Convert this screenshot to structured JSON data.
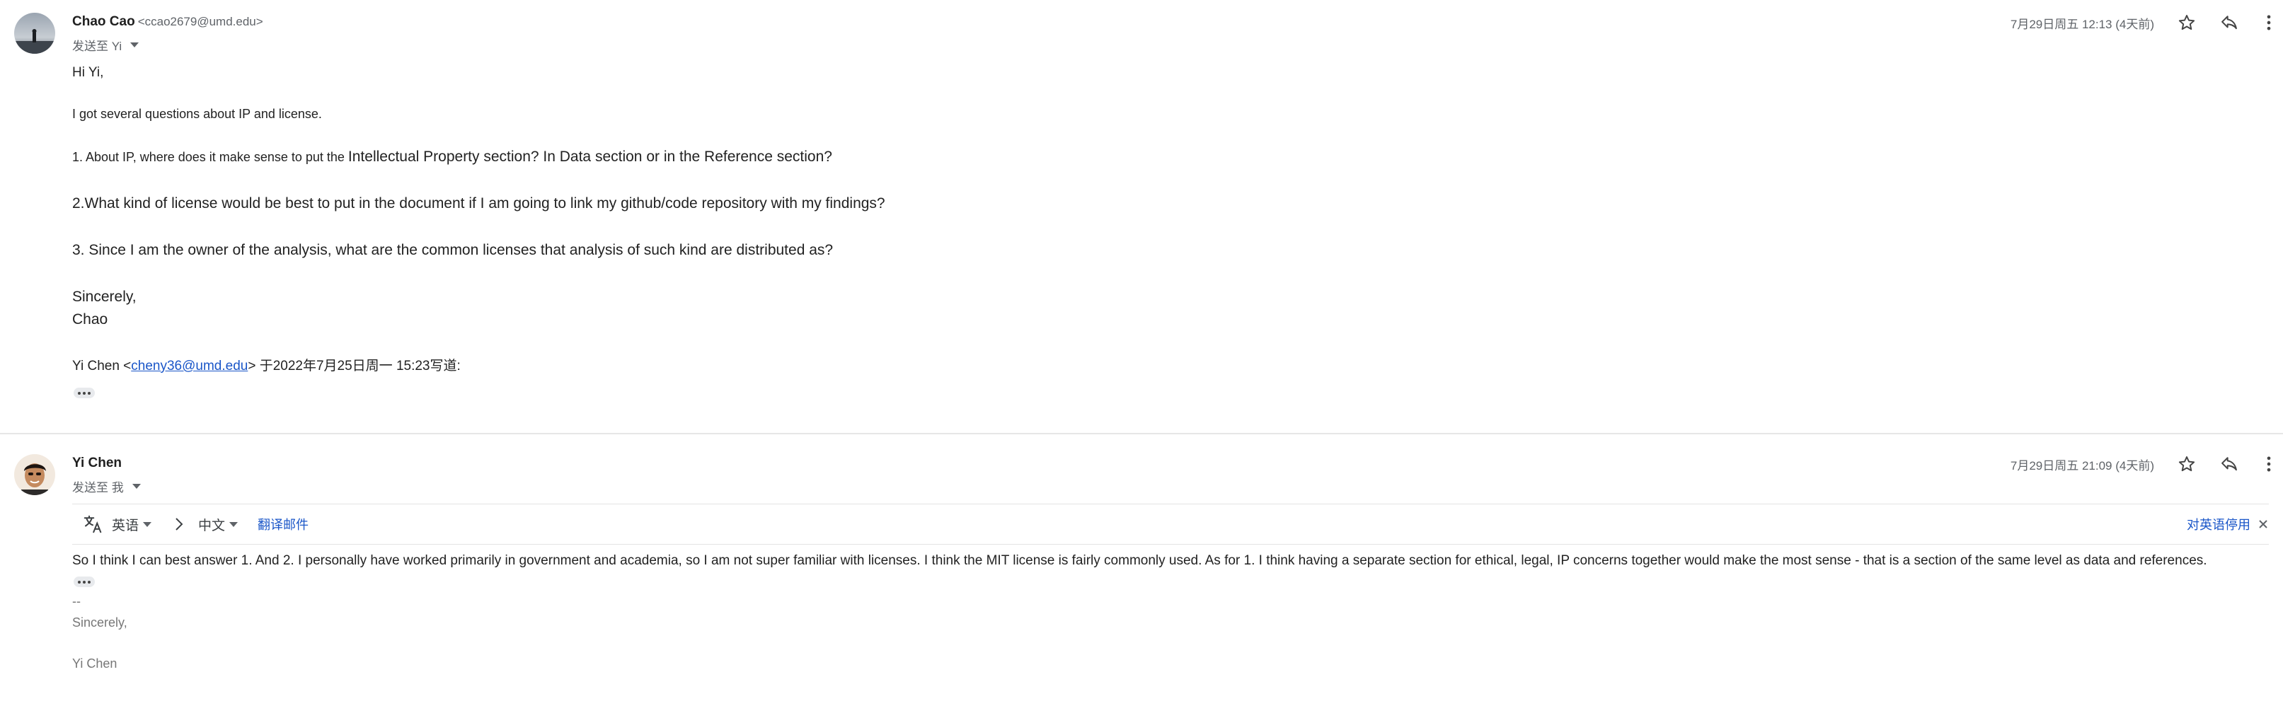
{
  "messages": [
    {
      "sender_name": "Chao Cao",
      "sender_email": "<ccao2679@umd.edu>",
      "sendto": "发送至 Yi",
      "date": "7月29日周五 12:13 (4天前)",
      "body": {
        "greeting": "Hi Yi,",
        "intro": "I got several questions about IP and license.",
        "q1_prefix": "1. About IP, where does it make sense to put the ",
        "q1_rest": "Intellectual Property section? In Data section or in the Reference section?",
        "q2": "2.What kind of license would be best to put in the document if I am going to link my github/code repository with my findings?",
        "q3": "3. Since I am the owner of the analysis, what are the common licenses that analysis of such kind are distributed as?",
        "closing": "Sincerely,",
        "name": "Chao",
        "quote_prefix": "Yi Chen <",
        "quote_email": "cheny36@umd.edu",
        "quote_suffix": "> 于2022年7月25日周一 15:23写道:"
      }
    },
    {
      "sender_name": "Yi Chen",
      "sendto": "发送至 我",
      "date": "7月29日周五 21:09 (4天前)",
      "translate": {
        "from_lang": "英语",
        "to_lang": "中文",
        "translate_link": "翻译邮件",
        "disable_link": "对英语停用"
      },
      "body": {
        "text": "So I think I can best answer 1. And 2. I personally have worked primarily in government and academia, so I am not super familiar with licenses. I think the MIT license is fairly commonly used. As for 1. I think having a separate section for ethical, legal, IP concerns together would make the most sense - that is a section of the same level as data and references.",
        "sig_dash": "--",
        "sig_closing": "Sincerely,",
        "sig_name": "Yi Chen"
      }
    }
  ],
  "icons": [
    "star-icon",
    "reply-icon",
    "more-vert-icon",
    "translate-icon",
    "chevron-right-icon",
    "close-icon"
  ],
  "colors": {
    "link": "#1a56c8",
    "secondary_text": "#5f6368"
  }
}
